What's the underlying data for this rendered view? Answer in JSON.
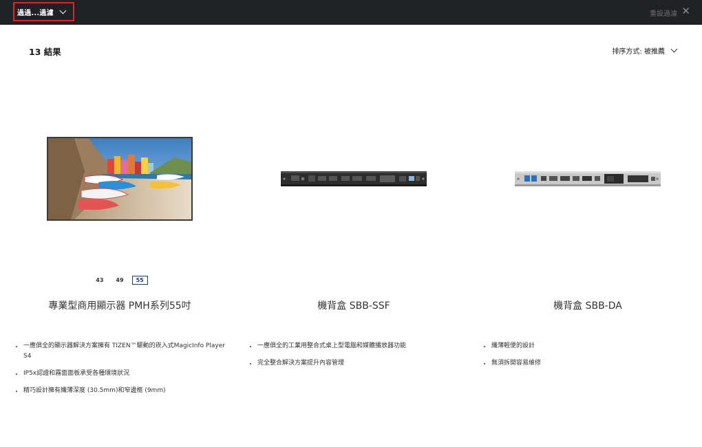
{
  "topbar": {
    "filter_label": "過過...過濾",
    "reset_label": "重設過濾",
    "close_symbol": "✕"
  },
  "results": {
    "count_label": "13 結果",
    "sort_label": "排序方式: 被推薦"
  },
  "products": [
    {
      "title": "專業型商用顯示器 PMH系列55吋",
      "sizes": [
        "43",
        "49",
        "55"
      ],
      "selected_size": "55",
      "features": [
        "一應俱全的顯示器解決方案擁有 TIZEN™驅動的崁入式MagicInfo Player S4",
        "IP5x認證和霧面面板承受各種環境狀況",
        "精巧設計擁有纖薄深度 (30.5mm)和窄邊框 (9mm)"
      ]
    },
    {
      "title": "機背盒 SBB-SSF",
      "features": [
        "一應俱全的工業用整合式桌上型電腦和媒體播放器功能",
        "完全整合解決方案提升內容管理"
      ]
    },
    {
      "title": "機背盒 SBB-DA",
      "features": [
        "纖薄輕便的設計",
        "無須拆開容易維修"
      ]
    }
  ],
  "colors": {
    "topbar_bg": "#202124",
    "focus_outline": "#e0222a",
    "size_active": "#1f3a6b"
  },
  "icons": {
    "filter_chevron": "chevron-down-icon",
    "close": "close-icon",
    "sort_chevron": "chevron-down-icon"
  }
}
